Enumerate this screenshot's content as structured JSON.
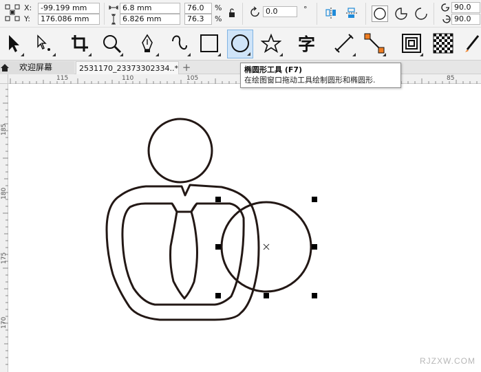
{
  "property_bar": {
    "x_label": "X:",
    "x_value": "-99.199 mm",
    "y_label": "Y:",
    "y_value": "176.086 mm",
    "width_value": "6.8 mm",
    "height_value": "6.826 mm",
    "scale_x": "76.0",
    "scale_y": "76.3",
    "percent": "%",
    "rotation": "0.0",
    "degree_symbol": "°",
    "start_angle": "90.0",
    "end_angle": "90.0"
  },
  "toolbox": {
    "tools": [
      "pick-tool",
      "shape-tool",
      "crop-tool",
      "zoom-tool",
      "pen-tool",
      "freehand-tool",
      "rectangle-tool",
      "ellipse-tool",
      "polygon-tool",
      "text-tool",
      "parallel-dimension-tool",
      "connector-tool",
      "blend-tool",
      "transparency-tool",
      "eyedropper-tool"
    ],
    "active_tool": "ellipse-tool",
    "text_tool_glyph": "字"
  },
  "tabs": {
    "welcome": "欢迎屏幕",
    "document": "2531170_23373302334..*",
    "add": "+"
  },
  "ruler": {
    "h_labels": [
      "115",
      "110",
      "105",
      "85"
    ],
    "v_labels": [
      "185",
      "180",
      "175",
      "170"
    ]
  },
  "tooltip": {
    "title": "椭圆形工具 (F7)",
    "description": "在绘图窗口拖动工具绘制圆形和椭圆形."
  },
  "watermark": "RJZXW.COM",
  "colors": {
    "accent": "#1f8ad8",
    "stroke": "#231815",
    "handle": "#000000",
    "active_tool_bg": "#cfe4f8"
  }
}
